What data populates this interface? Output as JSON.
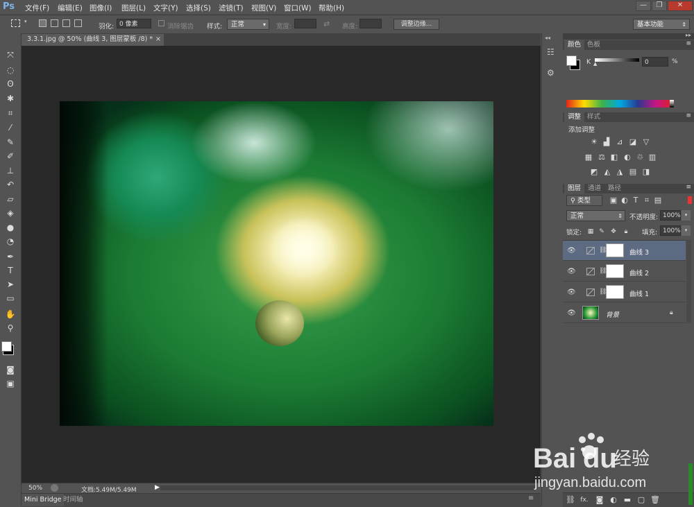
{
  "app": {
    "logo": "Ps"
  },
  "menu": [
    "文件(F)",
    "编辑(E)",
    "图像(I)",
    "图层(L)",
    "文字(Y)",
    "选择(S)",
    "滤镜(T)",
    "视图(V)",
    "窗口(W)",
    "帮助(H)"
  ],
  "window_controls": [
    "—",
    "❐",
    "✕"
  ],
  "options": {
    "feather_label": "羽化:",
    "feather_value": "0 像素",
    "antialias_label": "消除锯齿",
    "style_label": "样式:",
    "style_value": "正常",
    "width_label": "宽度:",
    "height_label": "高度:",
    "refine_edge": "调整边缘...",
    "workspace": "基本功能"
  },
  "document": {
    "tab_title": "3.3.1.jpg @ 50% (曲线 3, 图层蒙板 /8) *",
    "zoom": "50%",
    "doc_info": "文档:5.49M/5.49M"
  },
  "bottom_tabs": [
    "Mini Bridge",
    "时间轴"
  ],
  "color_panel": {
    "tabs": [
      "颜色",
      "色板"
    ],
    "channel_label": "K",
    "channel_value": "0",
    "percent": "%"
  },
  "adjust_panel": {
    "tabs": [
      "调整",
      "样式"
    ],
    "heading": "添加调整"
  },
  "layers_panel": {
    "tabs": [
      "图层",
      "通道",
      "路径"
    ],
    "filter_label": "类型",
    "blend_mode": "正常",
    "opacity_label": "不透明度:",
    "opacity_value": "100%",
    "lock_label": "锁定:",
    "fill_label": "填充:",
    "fill_value": "100%",
    "layers": [
      {
        "name": "曲线 3",
        "selected": true
      },
      {
        "name": "曲线 2",
        "selected": false
      },
      {
        "name": "曲线 1",
        "selected": false
      },
      {
        "name": "背景",
        "selected": false
      }
    ],
    "footer_icons": [
      "link-icon",
      "fx-icon",
      "mask-icon",
      "adjustment-icon",
      "folder-icon",
      "new-layer-icon",
      "trash-icon"
    ]
  },
  "watermark": {
    "brand_a": "Bai",
    "brand_b": "du",
    "brand_cn": "经验",
    "url": "jingyan.baidu.com"
  },
  "colors": {
    "ui_bg": "#535353",
    "canvas_bg": "#282828",
    "selection": "#5d6b82",
    "ps_blue": "#7fb3e8"
  }
}
